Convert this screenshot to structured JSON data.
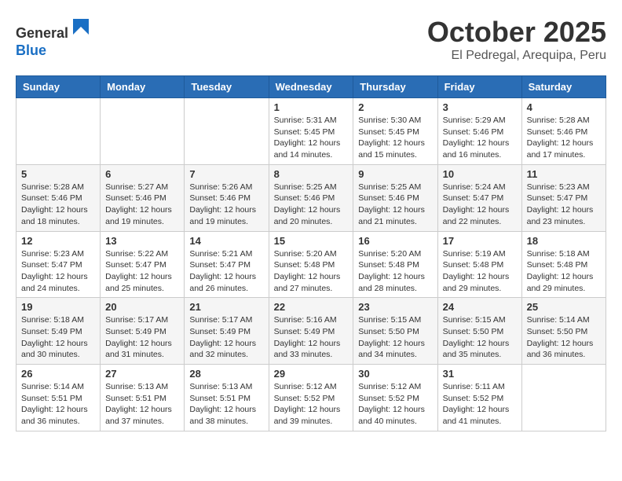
{
  "header": {
    "logo_general": "General",
    "logo_blue": "Blue",
    "month_title": "October 2025",
    "location": "El Pedregal, Arequipa, Peru"
  },
  "calendar": {
    "days_of_week": [
      "Sunday",
      "Monday",
      "Tuesday",
      "Wednesday",
      "Thursday",
      "Friday",
      "Saturday"
    ],
    "weeks": [
      [
        {
          "day": "",
          "info": ""
        },
        {
          "day": "",
          "info": ""
        },
        {
          "day": "",
          "info": ""
        },
        {
          "day": "1",
          "info": "Sunrise: 5:31 AM\nSunset: 5:45 PM\nDaylight: 12 hours and 14 minutes."
        },
        {
          "day": "2",
          "info": "Sunrise: 5:30 AM\nSunset: 5:45 PM\nDaylight: 12 hours and 15 minutes."
        },
        {
          "day": "3",
          "info": "Sunrise: 5:29 AM\nSunset: 5:46 PM\nDaylight: 12 hours and 16 minutes."
        },
        {
          "day": "4",
          "info": "Sunrise: 5:28 AM\nSunset: 5:46 PM\nDaylight: 12 hours and 17 minutes."
        }
      ],
      [
        {
          "day": "5",
          "info": "Sunrise: 5:28 AM\nSunset: 5:46 PM\nDaylight: 12 hours and 18 minutes."
        },
        {
          "day": "6",
          "info": "Sunrise: 5:27 AM\nSunset: 5:46 PM\nDaylight: 12 hours and 19 minutes."
        },
        {
          "day": "7",
          "info": "Sunrise: 5:26 AM\nSunset: 5:46 PM\nDaylight: 12 hours and 19 minutes."
        },
        {
          "day": "8",
          "info": "Sunrise: 5:25 AM\nSunset: 5:46 PM\nDaylight: 12 hours and 20 minutes."
        },
        {
          "day": "9",
          "info": "Sunrise: 5:25 AM\nSunset: 5:46 PM\nDaylight: 12 hours and 21 minutes."
        },
        {
          "day": "10",
          "info": "Sunrise: 5:24 AM\nSunset: 5:47 PM\nDaylight: 12 hours and 22 minutes."
        },
        {
          "day": "11",
          "info": "Sunrise: 5:23 AM\nSunset: 5:47 PM\nDaylight: 12 hours and 23 minutes."
        }
      ],
      [
        {
          "day": "12",
          "info": "Sunrise: 5:23 AM\nSunset: 5:47 PM\nDaylight: 12 hours and 24 minutes."
        },
        {
          "day": "13",
          "info": "Sunrise: 5:22 AM\nSunset: 5:47 PM\nDaylight: 12 hours and 25 minutes."
        },
        {
          "day": "14",
          "info": "Sunrise: 5:21 AM\nSunset: 5:47 PM\nDaylight: 12 hours and 26 minutes."
        },
        {
          "day": "15",
          "info": "Sunrise: 5:20 AM\nSunset: 5:48 PM\nDaylight: 12 hours and 27 minutes."
        },
        {
          "day": "16",
          "info": "Sunrise: 5:20 AM\nSunset: 5:48 PM\nDaylight: 12 hours and 28 minutes."
        },
        {
          "day": "17",
          "info": "Sunrise: 5:19 AM\nSunset: 5:48 PM\nDaylight: 12 hours and 29 minutes."
        },
        {
          "day": "18",
          "info": "Sunrise: 5:18 AM\nSunset: 5:48 PM\nDaylight: 12 hours and 29 minutes."
        }
      ],
      [
        {
          "day": "19",
          "info": "Sunrise: 5:18 AM\nSunset: 5:49 PM\nDaylight: 12 hours and 30 minutes."
        },
        {
          "day": "20",
          "info": "Sunrise: 5:17 AM\nSunset: 5:49 PM\nDaylight: 12 hours and 31 minutes."
        },
        {
          "day": "21",
          "info": "Sunrise: 5:17 AM\nSunset: 5:49 PM\nDaylight: 12 hours and 32 minutes."
        },
        {
          "day": "22",
          "info": "Sunrise: 5:16 AM\nSunset: 5:49 PM\nDaylight: 12 hours and 33 minutes."
        },
        {
          "day": "23",
          "info": "Sunrise: 5:15 AM\nSunset: 5:50 PM\nDaylight: 12 hours and 34 minutes."
        },
        {
          "day": "24",
          "info": "Sunrise: 5:15 AM\nSunset: 5:50 PM\nDaylight: 12 hours and 35 minutes."
        },
        {
          "day": "25",
          "info": "Sunrise: 5:14 AM\nSunset: 5:50 PM\nDaylight: 12 hours and 36 minutes."
        }
      ],
      [
        {
          "day": "26",
          "info": "Sunrise: 5:14 AM\nSunset: 5:51 PM\nDaylight: 12 hours and 36 minutes."
        },
        {
          "day": "27",
          "info": "Sunrise: 5:13 AM\nSunset: 5:51 PM\nDaylight: 12 hours and 37 minutes."
        },
        {
          "day": "28",
          "info": "Sunrise: 5:13 AM\nSunset: 5:51 PM\nDaylight: 12 hours and 38 minutes."
        },
        {
          "day": "29",
          "info": "Sunrise: 5:12 AM\nSunset: 5:52 PM\nDaylight: 12 hours and 39 minutes."
        },
        {
          "day": "30",
          "info": "Sunrise: 5:12 AM\nSunset: 5:52 PM\nDaylight: 12 hours and 40 minutes."
        },
        {
          "day": "31",
          "info": "Sunrise: 5:11 AM\nSunset: 5:52 PM\nDaylight: 12 hours and 41 minutes."
        },
        {
          "day": "",
          "info": ""
        }
      ]
    ]
  }
}
